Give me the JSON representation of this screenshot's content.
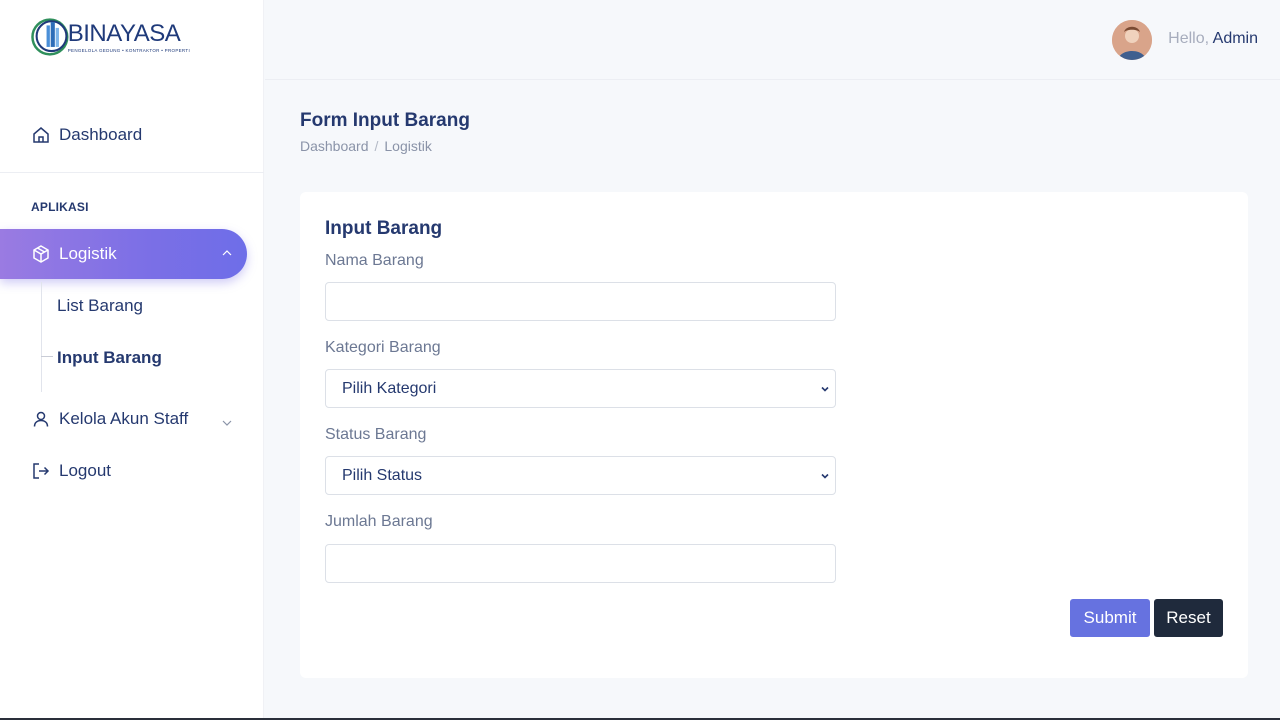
{
  "brand": {
    "name": "BINAYASA",
    "tagline": "PENGELOLA GEDUNG • KONTRAKTOR • PROPERTI"
  },
  "sidebar": {
    "dashboard_label": "Dashboard",
    "section_title": "APLIKASI",
    "logistik_label": "Logistik",
    "submenu": [
      "List Barang",
      "Input Barang"
    ],
    "kelola_label": "Kelola Akun Staff",
    "logout_label": "Logout"
  },
  "header": {
    "greeting": "Hello,",
    "user_name": "Admin"
  },
  "page": {
    "title": "Form Input Barang",
    "breadcrumb": [
      "Dashboard",
      "Logistik"
    ],
    "breadcrumb_sep": "/"
  },
  "form": {
    "card_title": "Input Barang",
    "nama_label": "Nama Barang",
    "nama_value": "",
    "kategori_label": "Kategori Barang",
    "kategori_selected": "Pilih Kategori",
    "status_label": "Status Barang",
    "status_selected": "Pilih Status",
    "jumlah_label": "Jumlah Barang",
    "jumlah_value": "",
    "submit_label": "Submit",
    "reset_label": "Reset"
  },
  "colors": {
    "accent": "#6672e0",
    "active_gradient_start": "#9a7be2",
    "dark_button": "#1f2a3c",
    "text": "#25396f"
  },
  "icons": {
    "dashboard": "home-icon",
    "logistik": "box-icon",
    "kelola": "user-icon",
    "logout": "logout-icon"
  }
}
